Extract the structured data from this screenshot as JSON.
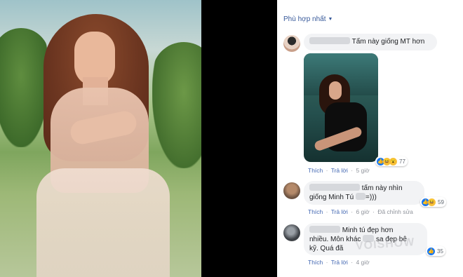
{
  "panel": {
    "sort_label": "Phù hợp nhất"
  },
  "comments": [
    {
      "text": "Tấm này giống MT hơn",
      "emoji": "🤣",
      "has_image": true,
      "reaction_count": "77",
      "actions": {
        "like": "Thích",
        "reply": "Trả lời",
        "time": "5 giờ"
      }
    },
    {
      "line1": "tấm này nhìn",
      "line2": "giống Minh Tú",
      "line2_end": "=)))",
      "reaction_count": "59",
      "actions": {
        "like": "Thích",
        "reply": "Trả lời",
        "time": "6 giờ",
        "edited": "Đã chỉnh sửa"
      }
    },
    {
      "line1": "Minh tú đẹp hơn",
      "line2a": "nhiều. Môn khác",
      "line2b": "sa đẹp bê",
      "line3": "kỹ. Quá đã",
      "reaction_count": "35",
      "actions": {
        "like": "Thích",
        "reply": "Trả lời",
        "time": "4 giờ"
      }
    }
  ],
  "watermark": "VOISHOW",
  "colors": {
    "link": "#385898",
    "bubble": "#f2f3f5",
    "like": "#1877f2"
  }
}
